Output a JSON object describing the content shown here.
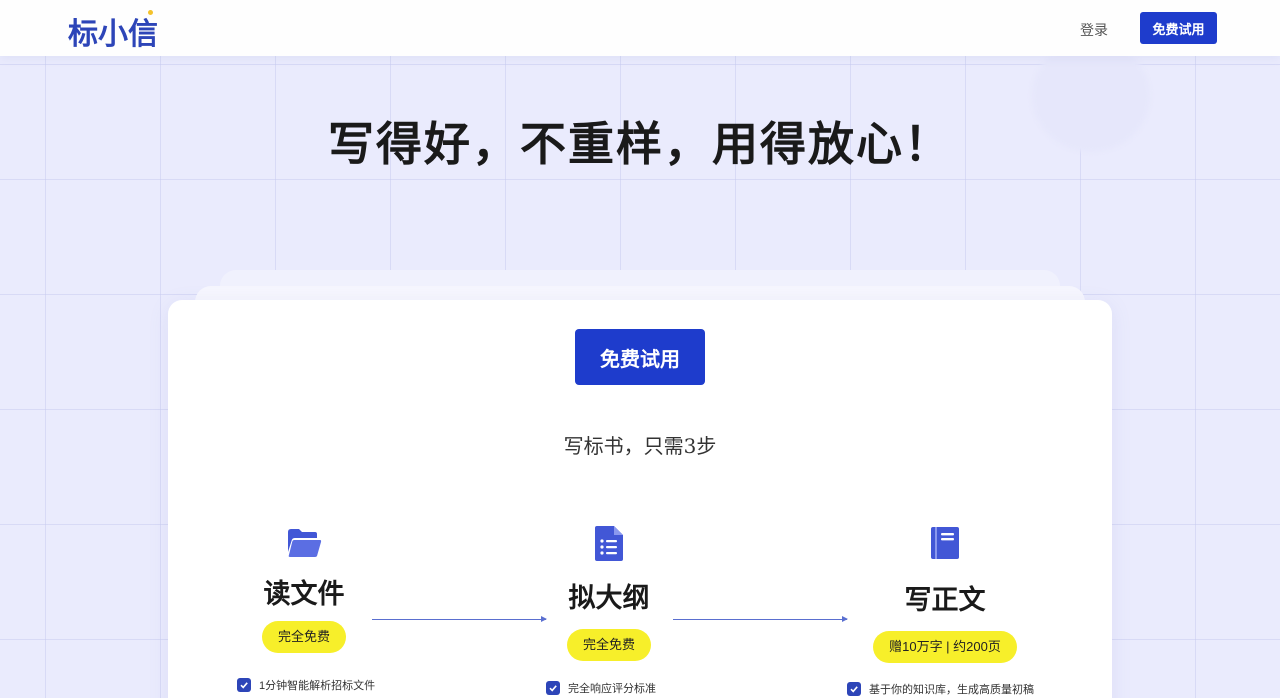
{
  "header": {
    "logo": "标小信",
    "login_label": "登录",
    "trial_label": "免费试用"
  },
  "hero": {
    "title": "写得好，不重样，用得放心！"
  },
  "card": {
    "cta_label": "免费试用",
    "subtitle": "写标书，只需3步",
    "steps": [
      {
        "icon": "folder-open-icon",
        "title": "读文件",
        "badge": "完全免费",
        "feature": "1分钟智能解析招标文件"
      },
      {
        "icon": "document-list-icon",
        "title": "拟大纲",
        "badge": "完全免费",
        "feature": "完全响应评分标准"
      },
      {
        "icon": "book-icon",
        "title": "写正文",
        "badge": "赠10万字 | 约200页",
        "feature": "基于你的知识库，生成高质量初稿"
      }
    ]
  },
  "colors": {
    "brand": "#1e3ccc",
    "logo": "#2d45b8",
    "badge": "#f7ef2a",
    "background": "#eaebfd"
  }
}
